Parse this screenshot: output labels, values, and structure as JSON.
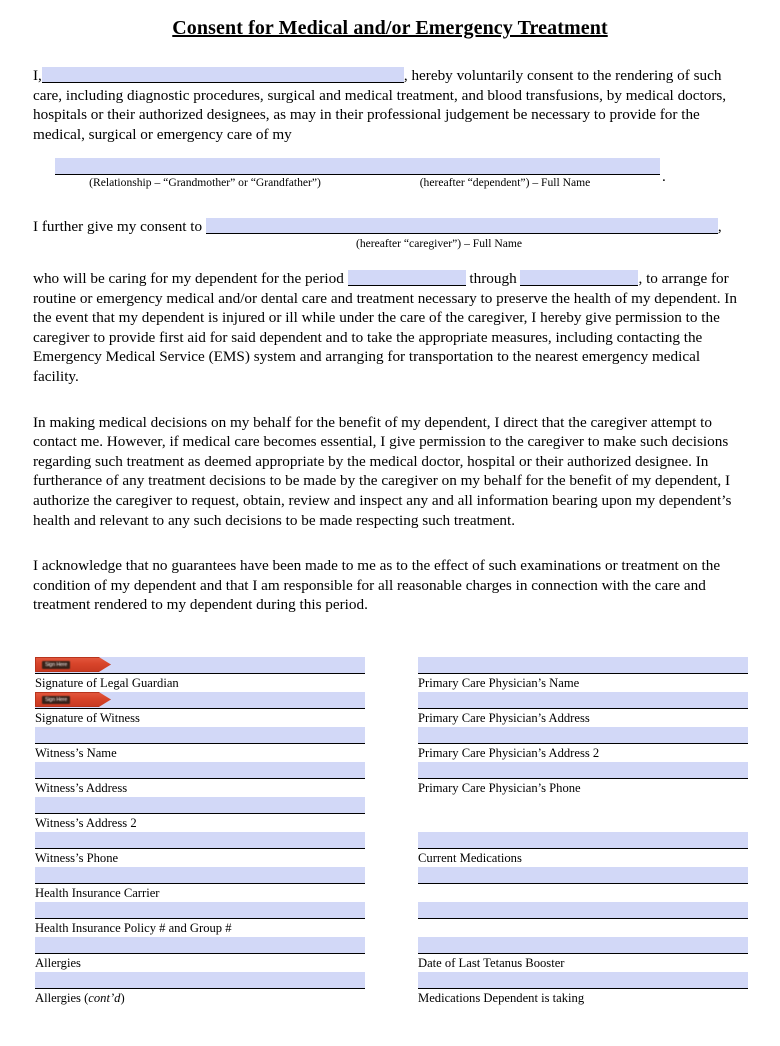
{
  "document": {
    "title": "Consent for Medical and/or Emergency Treatment"
  },
  "paragraphs": {
    "p1_before": "I,",
    "p1_after": ", hereby voluntarily consent to the rendering of such care, including diagnostic procedures, surgical and medical treatment, and blood transfusions, by medical doctors, hospitals or their authorized designees, as may in their professional judgement be necessary to provide for the medical, surgical or emergency care of my",
    "relationship_caption": "(Relationship – “Grandmother” or “Grandfather”)",
    "dependent_caption": "(hereafter “dependent”) – Full Name",
    "dependent_trailing_punct": ".",
    "p2_before": "I further give my consent to",
    "p2_after": ",",
    "caregiver_caption": "(hereafter “caregiver”) – Full Name",
    "p3_before": "who will be caring for my dependent for the period",
    "p3_middle": "through",
    "p3_after": ", to arrange for routine or emergency medical and/or dental care and treatment necessary to preserve the health of my dependent.  In the event that my dependent is injured or ill while under the care of the caregiver, I hereby give permission to the caregiver to provide first aid for said dependent and to take the appropriate measures, including contacting the Emergency Medical Service (EMS) system and arranging for transportation to the nearest emergency medical facility.",
    "p4": "In making medical decisions on my behalf for the benefit of my dependent, I direct that the caregiver attempt to contact me.  However, if medical care becomes essential, I give permission to the caregiver to make such decisions regarding such treatment as deemed appropriate by the medical doctor, hospital or their authorized designee.  In furtherance of any treatment decisions to be made by the caregiver on my behalf for the benefit of my dependent, I authorize the caregiver to request, obtain, review and inspect any and all information bearing upon my dependent’s health and relevant to any such decisions to be made respecting such treatment.",
    "p5": "I acknowledge that no guarantees have been made to me as to the effect of such examinations or treatment on the condition of my dependent and that I am responsible for all reasonable charges in connection with the care and treatment rendered to my dependent during this period."
  },
  "signature_tag": {
    "label": "Sign Here",
    "color": "#d8442a"
  },
  "form": {
    "field_fill_color": "#d2d8f7",
    "left_column": [
      {
        "label": "Signature of Legal Guardian",
        "has_signature_tag": true
      },
      {
        "label": "Signature of Witness",
        "has_signature_tag": true
      },
      {
        "label": "Witness’s Name",
        "has_signature_tag": false
      },
      {
        "label": "Witness’s Address",
        "has_signature_tag": false
      },
      {
        "label": "Witness’s Address 2",
        "has_signature_tag": false
      },
      {
        "label": "Witness’s Phone",
        "has_signature_tag": false
      },
      {
        "label": "Health Insurance Carrier",
        "has_signature_tag": false
      },
      {
        "label": "Health Insurance Policy # and Group #",
        "has_signature_tag": false
      },
      {
        "label": "Allergies",
        "has_signature_tag": false
      },
      {
        "label": "Allergies (cont’d)",
        "label_italic_part": "cont’d",
        "has_signature_tag": false
      }
    ],
    "right_column": [
      {
        "label": "Primary Care Physician’s Name",
        "has_signature_tag": false
      },
      {
        "label": "Primary Care Physician’s Address",
        "has_signature_tag": false
      },
      {
        "label": "Primary Care Physician’s Address 2",
        "has_signature_tag": false
      },
      {
        "label": "Primary Care Physician’s Phone",
        "has_signature_tag": false
      },
      {
        "label": "",
        "empty_slot": true
      },
      {
        "label": "Current Medications",
        "has_signature_tag": false
      },
      {
        "label": "",
        "has_signature_tag": false
      },
      {
        "label": "",
        "has_signature_tag": false
      },
      {
        "label": "Date of Last Tetanus Booster",
        "has_signature_tag": false
      },
      {
        "label": "Medications Dependent is taking",
        "has_signature_tag": false
      }
    ]
  }
}
